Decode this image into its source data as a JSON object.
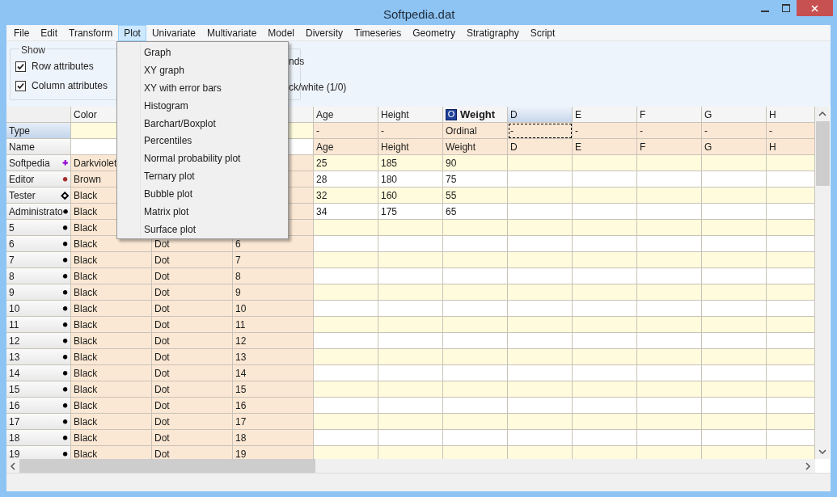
{
  "window": {
    "title": "Softpedia.dat"
  },
  "menu_bar": [
    {
      "label": "File",
      "selected": false
    },
    {
      "label": "Edit",
      "selected": false
    },
    {
      "label": "Transform",
      "selected": false
    },
    {
      "label": "Plot",
      "selected": true
    },
    {
      "label": "Univariate",
      "selected": false
    },
    {
      "label": "Multivariate",
      "selected": false
    },
    {
      "label": "Model",
      "selected": false
    },
    {
      "label": "Diversity",
      "selected": false
    },
    {
      "label": "Timeseries",
      "selected": false
    },
    {
      "label": "Geometry",
      "selected": false
    },
    {
      "label": "Stratigraphy",
      "selected": false
    },
    {
      "label": "Script",
      "selected": false
    }
  ],
  "plot_menu": [
    "Graph",
    "XY graph",
    "XY with error bars",
    "Histogram",
    "Barchart/Boxplot",
    "Percentiles",
    "Normal probability plot",
    "Ternary plot",
    "Bubble plot",
    "Matrix plot",
    "Surface plot"
  ],
  "options": {
    "group_title": "Show",
    "checkboxes": [
      {
        "label": "Row attributes",
        "checked": true
      },
      {
        "label": "Column attributes",
        "checked": true
      }
    ],
    "partial_texts": [
      "nds",
      "ck/white (1/0)"
    ]
  },
  "grid": {
    "color_column": {
      "label": "Color",
      "selected": false
    },
    "columns": [
      {
        "label": "Age",
        "selected": false
      },
      {
        "label": "Height",
        "selected": false
      },
      {
        "label": "Weight",
        "badge": "O",
        "selected": false
      },
      {
        "label": "D",
        "selected": true
      },
      {
        "label": "E",
        "selected": false
      },
      {
        "label": "F",
        "selected": false
      },
      {
        "label": "G",
        "selected": false
      },
      {
        "label": "H",
        "selected": false
      }
    ],
    "type_row": {
      "label": "Type",
      "selected": true,
      "cells": [
        {
          "text": "-",
          "focused": false
        },
        {
          "text": "-",
          "focused": false
        },
        {
          "text": "Ordinal",
          "focused": false
        },
        {
          "text": "-",
          "focused": true
        },
        {
          "text": "-",
          "focused": false
        },
        {
          "text": "-",
          "focused": false
        },
        {
          "text": "-",
          "focused": false
        },
        {
          "text": "-",
          "focused": false
        }
      ]
    },
    "name_row": {
      "label": "Name",
      "selected": false,
      "cells": [
        "Age",
        "Height",
        "Weight",
        "D",
        "E",
        "F",
        "G",
        "H"
      ]
    },
    "rows": [
      {
        "label": "Softpedia",
        "marker": "+",
        "color": "#9400d3",
        "color_name": "Darkviolet",
        "values": [
          "25",
          "185",
          "90"
        ]
      },
      {
        "label": "Editor",
        "marker": "●",
        "color": "#a52a2a",
        "color_name": "Brown",
        "values": [
          "28",
          "180",
          "75"
        ]
      },
      {
        "label": "Tester",
        "marker": "◇",
        "color": "#000000",
        "color_name": "Black",
        "values": [
          "32",
          "160",
          "55"
        ]
      },
      {
        "label": "Administrato",
        "marker": "●",
        "color": "#000000",
        "color_name": "Black",
        "values": [
          "34",
          "175",
          "65"
        ]
      },
      {
        "label": "5",
        "marker": "●",
        "color": "#000000",
        "color_name": "Black"
      },
      {
        "label": "6",
        "marker": "●",
        "color": "#000000",
        "color_name": "Black",
        "column_3": "Dot",
        "column_4": "6"
      },
      {
        "label": "7",
        "marker": "●",
        "color": "#000000",
        "color_name": "Black",
        "column_3": "Dot",
        "column_4": "7"
      },
      {
        "label": "8",
        "marker": "●",
        "color": "#000000",
        "color_name": "Black",
        "column_3": "Dot",
        "column_4": "8"
      },
      {
        "label": "9",
        "marker": "●",
        "color": "#000000",
        "color_name": "Black",
        "column_3": "Dot",
        "column_4": "9"
      },
      {
        "label": "10",
        "marker": "●",
        "color": "#000000",
        "color_name": "Black",
        "column_3": "Dot",
        "column_4": "10"
      },
      {
        "label": "11",
        "marker": "●",
        "color": "#000000",
        "color_name": "Black",
        "column_3": "Dot",
        "column_4": "11"
      },
      {
        "label": "12",
        "marker": "●",
        "color": "#000000",
        "color_name": "Black",
        "column_3": "Dot",
        "column_4": "12"
      },
      {
        "label": "13",
        "marker": "●",
        "color": "#000000",
        "color_name": "Black",
        "column_3": "Dot",
        "column_4": "13"
      },
      {
        "label": "14",
        "marker": "●",
        "color": "#000000",
        "color_name": "Black",
        "column_3": "Dot",
        "column_4": "14"
      },
      {
        "label": "15",
        "marker": "●",
        "color": "#000000",
        "color_name": "Black",
        "column_3": "Dot",
        "column_4": "15"
      },
      {
        "label": "16",
        "marker": "●",
        "color": "#000000",
        "color_name": "Black",
        "column_3": "Dot",
        "column_4": "16"
      },
      {
        "label": "17",
        "marker": "●",
        "color": "#000000",
        "color_name": "Black",
        "column_3": "Dot",
        "column_4": "17"
      },
      {
        "label": "18",
        "marker": "●",
        "color": "#000000",
        "color_name": "Black",
        "column_3": "Dot",
        "column_4": "18"
      },
      {
        "label": "19",
        "marker": "●",
        "color": "#000000",
        "color_name": "Black",
        "column_3": "Dot",
        "column_4": "19"
      }
    ]
  }
}
